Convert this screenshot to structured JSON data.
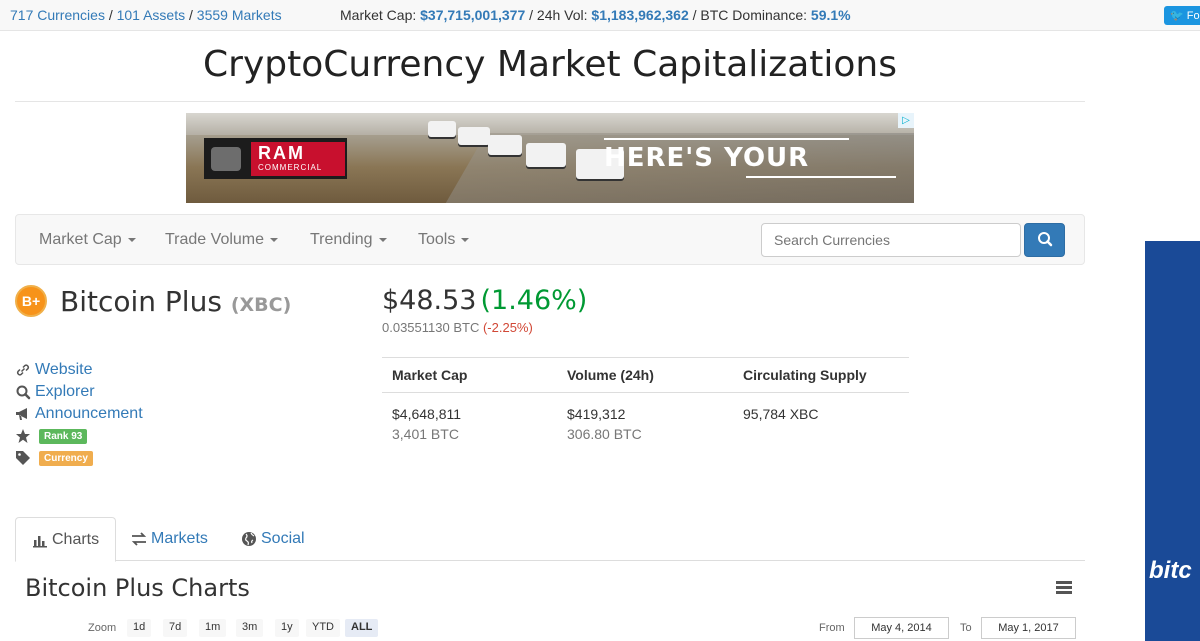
{
  "topbar": {
    "currencies": "717 Currencies",
    "assets": "101 Assets",
    "markets": "3559 Markets",
    "sep": "/",
    "market_cap_label": "Market Cap:",
    "market_cap_value": "$37,715,001,377",
    "vol_label": "24h Vol:",
    "vol_value": "$1,183,962,362",
    "dominance_label": "BTC Dominance:",
    "dominance_value": "59.1%",
    "twitter_label": "Fo"
  },
  "site_title": "CryptoCurrency Market Capitalizations",
  "ad": {
    "brand": "RAM",
    "brand_sub": "COMMERCIAL",
    "headline": "HERE'S YOUR",
    "adchoices": "▷"
  },
  "nav": {
    "items": [
      "Market Cap",
      "Trade Volume",
      "Trending",
      "Tools"
    ],
    "search_placeholder": "Search Currencies"
  },
  "coin": {
    "logo_glyph": "B+",
    "name": "Bitcoin Plus",
    "symbol": "(XBC)",
    "price": "$48.53",
    "price_change": "(1.46%)",
    "btc_price": "0.03551130 BTC",
    "btc_change": "(-2.25%)"
  },
  "links": {
    "website": "Website",
    "explorer": "Explorer",
    "announcement": "Announcement",
    "rank": "Rank 93",
    "type": "Currency"
  },
  "stats": {
    "headers": [
      "Market Cap",
      "Volume (24h)",
      "Circulating Supply"
    ],
    "market_cap_usd": "$4,648,811",
    "market_cap_btc": "3,401 BTC",
    "volume_usd": "$419,312",
    "volume_btc": "306.80 BTC",
    "supply": "95,784 XBC"
  },
  "tabs": [
    "Charts",
    "Markets",
    "Social"
  ],
  "charts_title": "Bitcoin Plus Charts",
  "zoom": {
    "label": "Zoom",
    "options": [
      "1d",
      "7d",
      "1m",
      "3m",
      "1y",
      "YTD",
      "ALL"
    ],
    "from_label": "From",
    "from_value": "May 4, 2014",
    "to_label": "To",
    "to_value": "May 1, 2017"
  },
  "side_ad": {
    "text": "bitc"
  },
  "colors": {
    "link": "#337ab7",
    "positive": "#009933",
    "negative": "#d14836",
    "side_ad_bg": "#1a4a97"
  }
}
